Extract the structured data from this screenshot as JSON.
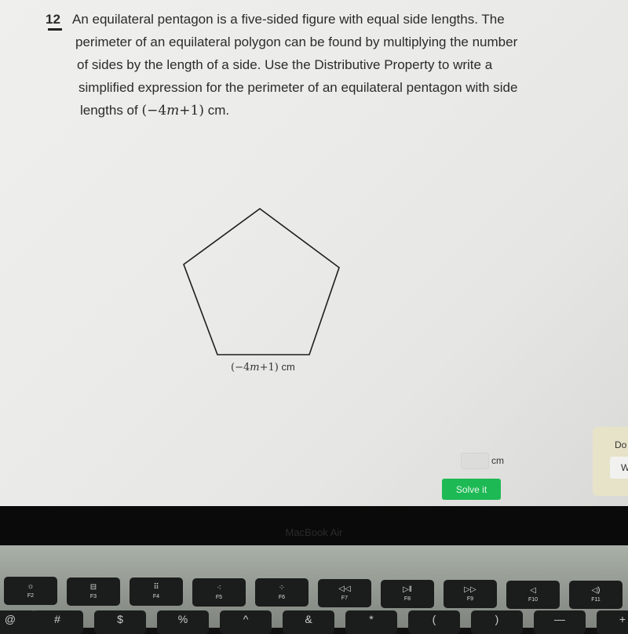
{
  "question": {
    "number": "12",
    "lines": [
      "An equilateral pentagon is a five-sided figure with equal side lengths. The",
      "perimeter of an equilateral polygon can be found by multiplying the number",
      "of sides by the length of a side. Use the Distributive Property to write a",
      "simplified expression for the perimeter of an equilateral pentagon with side"
    ],
    "last_line_prefix": "lengths of ",
    "expression_open": "(−4",
    "expression_var": "m",
    "expression_close": "+1)",
    "last_line_suffix": " cm."
  },
  "figure": {
    "shape": "regular pentagon",
    "side_label_open": "(−4",
    "side_label_var": "m",
    "side_label_close": "+1)",
    "side_label_unit": " cm"
  },
  "answer": {
    "input_value": "",
    "unit": "cm",
    "solve_button": "Solve it"
  },
  "side_panel": {
    "text": "Do",
    "box_text": "W"
  },
  "laptop": {
    "brand": "MacBook Air",
    "function_keys": [
      {
        "glyph": "☼",
        "label": "F2",
        "icon": "brightness-up-icon"
      },
      {
        "glyph": "⊟",
        "label": "F3",
        "icon": "mission-control-icon"
      },
      {
        "glyph": "⠿",
        "label": "F4",
        "icon": "launchpad-icon"
      },
      {
        "glyph": "⁖",
        "label": "F5",
        "icon": "keyboard-light-down-icon"
      },
      {
        "glyph": "⁘",
        "label": "F6",
        "icon": "keyboard-light-up-icon"
      },
      {
        "glyph": "◁◁",
        "label": "F7",
        "icon": "rewind-icon"
      },
      {
        "glyph": "▷‖",
        "label": "F8",
        "icon": "play-pause-icon"
      },
      {
        "glyph": "▷▷",
        "label": "F9",
        "icon": "fast-forward-icon"
      },
      {
        "glyph": "◁",
        "label": "F10",
        "icon": "mute-icon"
      },
      {
        "glyph": "◁)",
        "label": "F11",
        "icon": "volume-down-icon"
      }
    ],
    "number_keys": [
      "@",
      "#",
      "$",
      "%",
      "^",
      "&",
      "*",
      "(",
      ")",
      "—",
      "+"
    ]
  }
}
